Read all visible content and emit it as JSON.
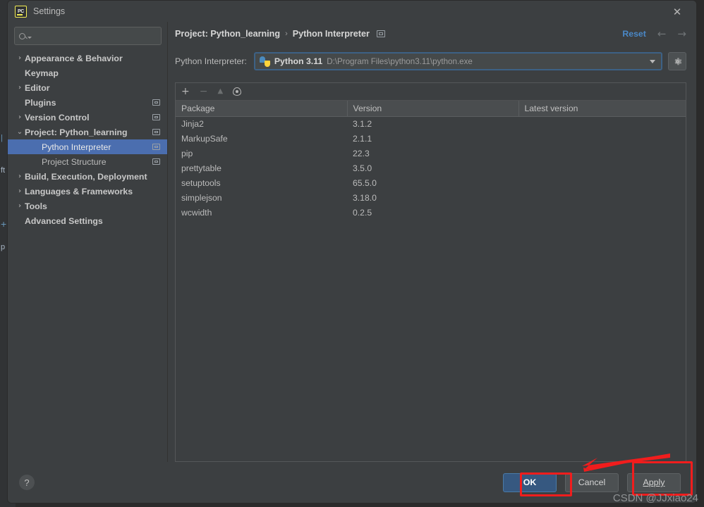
{
  "window": {
    "title": "Settings",
    "logo_text": "PC",
    "close_label": "✕"
  },
  "sidebar": {
    "search": {
      "placeholder": "",
      "value": "",
      "icon": "search-icon"
    },
    "items": [
      {
        "label": "Appearance & Behavior",
        "chevron": "›",
        "expandable": true,
        "bold": true,
        "indent": 0,
        "badge": false,
        "selected": false
      },
      {
        "label": "Keymap",
        "chevron": "",
        "expandable": false,
        "bold": true,
        "indent": 0,
        "badge": false,
        "selected": false
      },
      {
        "label": "Editor",
        "chevron": "›",
        "expandable": true,
        "bold": true,
        "indent": 0,
        "badge": false,
        "selected": false
      },
      {
        "label": "Plugins",
        "chevron": "",
        "expandable": false,
        "bold": true,
        "indent": 0,
        "badge": true,
        "selected": false
      },
      {
        "label": "Version Control",
        "chevron": "›",
        "expandable": true,
        "bold": true,
        "indent": 0,
        "badge": true,
        "selected": false
      },
      {
        "label": "Project: Python_learning",
        "chevron": "⌄",
        "expandable": true,
        "bold": true,
        "indent": 0,
        "badge": true,
        "selected": false
      },
      {
        "label": "Python Interpreter",
        "chevron": "",
        "expandable": false,
        "bold": false,
        "indent": 1,
        "badge": true,
        "selected": true
      },
      {
        "label": "Project Structure",
        "chevron": "",
        "expandable": false,
        "bold": false,
        "indent": 1,
        "badge": true,
        "selected": false
      },
      {
        "label": "Build, Execution, Deployment",
        "chevron": "›",
        "expandable": true,
        "bold": true,
        "indent": 0,
        "badge": false,
        "selected": false
      },
      {
        "label": "Languages & Frameworks",
        "chevron": "›",
        "expandable": true,
        "bold": true,
        "indent": 0,
        "badge": false,
        "selected": false
      },
      {
        "label": "Tools",
        "chevron": "›",
        "expandable": true,
        "bold": true,
        "indent": 0,
        "badge": false,
        "selected": false
      },
      {
        "label": "Advanced Settings",
        "chevron": "",
        "expandable": false,
        "bold": true,
        "indent": 0,
        "badge": false,
        "selected": false
      }
    ]
  },
  "header": {
    "breadcrumb_project": "Project: Python_learning",
    "breadcrumb_separator": "›",
    "breadcrumb_page": "Python Interpreter",
    "reset_label": "Reset",
    "back_arrow": "←",
    "forward_arrow": "→"
  },
  "interpreter": {
    "label": "Python Interpreter:",
    "name": "Python 3.11",
    "path": "D:\\Program Files\\python3.11\\python.exe",
    "gear_tooltip": "gear-icon"
  },
  "packages": {
    "toolbar": {
      "add": "+",
      "remove": "−",
      "upgrade": "▲",
      "show_early": "eye-icon"
    },
    "columns": [
      "Package",
      "Version",
      "Latest version"
    ],
    "rows": [
      {
        "package": "Jinja2",
        "version": "3.1.2",
        "latest": ""
      },
      {
        "package": "MarkupSafe",
        "version": "2.1.1",
        "latest": ""
      },
      {
        "package": "pip",
        "version": "22.3",
        "latest": ""
      },
      {
        "package": "prettytable",
        "version": "3.5.0",
        "latest": ""
      },
      {
        "package": "setuptools",
        "version": "65.5.0",
        "latest": ""
      },
      {
        "package": "simplejson",
        "version": "3.18.0",
        "latest": ""
      },
      {
        "package": "wcwidth",
        "version": "0.2.5",
        "latest": ""
      }
    ]
  },
  "footer": {
    "help_label": "?",
    "ok_label": "OK",
    "cancel_label": "Cancel",
    "apply_label": "Apply"
  },
  "annotations": {
    "watermark": "CSDN @JJxiao24",
    "highlight_color": "#f11d1d"
  }
}
